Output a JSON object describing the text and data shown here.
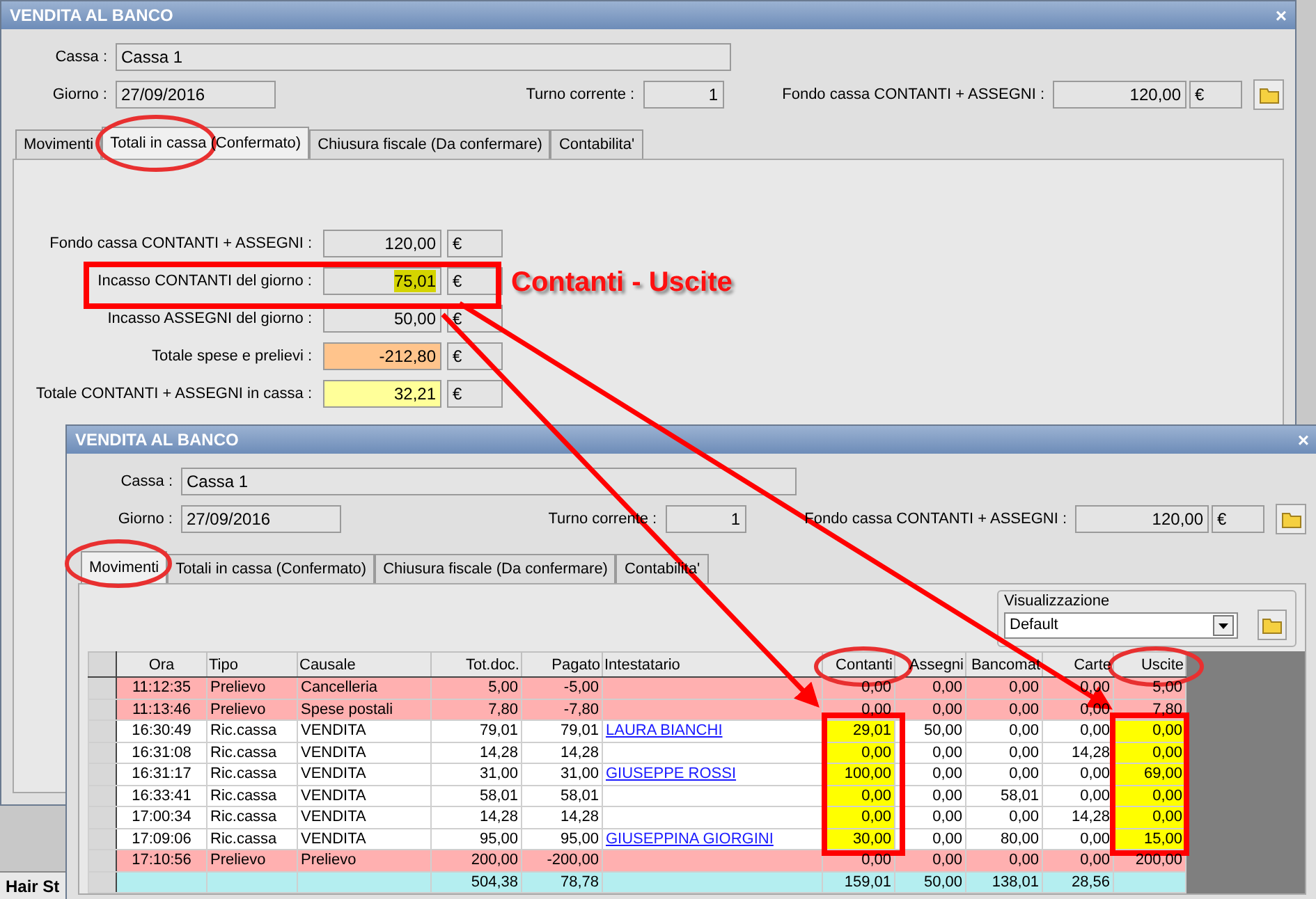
{
  "back_window": {
    "title": "VENDITA AL BANCO",
    "close": "×",
    "header": {
      "cassa_label": "Cassa :",
      "cassa": "Cassa 1",
      "giorno_label": "Giorno :",
      "giorno": "27/09/2016",
      "turno_label": "Turno corrente :",
      "turno": "1",
      "fondo_label": "Fondo cassa CONTANTI + ASSEGNI :",
      "fondo": "120,00",
      "fondo_unit": "€"
    },
    "tabs": [
      {
        "label": "Movimenti",
        "selected": false
      },
      {
        "label": "Totali in cassa (Confermato)",
        "selected": true
      },
      {
        "label": "Chiusura fiscale (Da confermare)",
        "selected": false
      },
      {
        "label": "Contabilita'",
        "selected": false
      }
    ],
    "totals": [
      {
        "label": "Fondo cassa CONTANTI + ASSEGNI :",
        "value": "120,00",
        "unit": "€",
        "kind": "plain"
      },
      {
        "label": "Incasso CONTANTI del giorno :",
        "value": "75,01",
        "unit": "€",
        "kind": "marked"
      },
      {
        "label": "Incasso ASSEGNI del giorno :",
        "value": "50,00",
        "unit": "€",
        "kind": "plain"
      },
      {
        "label": "Totale spese e prelievi :",
        "value": "-212,80",
        "unit": "€",
        "kind": "expense"
      },
      {
        "label": "Totale CONTANTI + ASSEGNI in cassa :",
        "value": "32,21",
        "unit": "€",
        "kind": "total"
      }
    ]
  },
  "annotation": {
    "text": "Contanti - Uscite"
  },
  "taskbar": {
    "item": "Hair St"
  },
  "front_window": {
    "title": "VENDITA AL BANCO",
    "close": "×",
    "header": {
      "cassa_label": "Cassa :",
      "cassa": "Cassa 1",
      "giorno_label": "Giorno :",
      "giorno": "27/09/2016",
      "turno_label": "Turno corrente :",
      "turno": "1",
      "fondo_label": "Fondo cassa CONTANTI + ASSEGNI :",
      "fondo": "120,00",
      "fondo_unit": "€"
    },
    "tabs": [
      {
        "label": "Movimenti",
        "selected": true
      },
      {
        "label": "Totali in cassa (Confermato)",
        "selected": false
      },
      {
        "label": "Chiusura fiscale (Da confermare)",
        "selected": false
      },
      {
        "label": "Contabilita'",
        "selected": false
      }
    ],
    "view_group": {
      "legend": "Visualizzazione",
      "value": "Default"
    },
    "table": {
      "columns": [
        {
          "label": "Ora"
        },
        {
          "label": "Tipo"
        },
        {
          "label": "Causale"
        },
        {
          "label": "Tot.doc."
        },
        {
          "label": "Pagato"
        },
        {
          "label": "Intestatario"
        },
        {
          "label": "Contanti"
        },
        {
          "label": "Assegni"
        },
        {
          "label": "Bancomat"
        },
        {
          "label": "Carte"
        },
        {
          "label": "Uscite"
        }
      ],
      "rows": [
        {
          "kind": "prelievo",
          "highlighted": false,
          "ora": "11:12:35",
          "tipo": "Prelievo",
          "causale": "Cancelleria",
          "tot_doc": "5,00",
          "pagato": "-5,00",
          "contanti": "0,00",
          "assegni": "0,00",
          "bancomat": "0,00",
          "carte": "0,00",
          "uscite": "5,00"
        },
        {
          "kind": "prelievo",
          "highlighted": false,
          "ora": "11:13:46",
          "tipo": "Prelievo",
          "causale": "Spese postali",
          "tot_doc": "7,80",
          "pagato": "-7,80",
          "contanti": "0,00",
          "assegni": "0,00",
          "bancomat": "0,00",
          "carte": "0,00",
          "uscite": "7,80"
        },
        {
          "kind": "incasso",
          "highlighted": true,
          "ora": "16:30:49",
          "tipo": "Ric.cassa",
          "causale": "VENDITA",
          "tot_doc": "79,01",
          "pagato": "79,01",
          "intestatario": "LAURA BIANCHI",
          "contanti": "29,01",
          "assegni": "50,00",
          "bancomat": "0,00",
          "carte": "0,00",
          "uscite": "0,00"
        },
        {
          "kind": "incasso",
          "highlighted": true,
          "ora": "16:31:08",
          "tipo": "Ric.cassa",
          "causale": "VENDITA",
          "tot_doc": "14,28",
          "pagato": "14,28",
          "contanti": "0,00",
          "assegni": "0,00",
          "bancomat": "0,00",
          "carte": "14,28",
          "uscite": "0,00"
        },
        {
          "kind": "incasso",
          "highlighted": true,
          "ora": "16:31:17",
          "tipo": "Ric.cassa",
          "causale": "VENDITA",
          "tot_doc": "31,00",
          "pagato": "31,00",
          "intestatario": "GIUSEPPE ROSSI",
          "contanti": "100,00",
          "assegni": "0,00",
          "bancomat": "0,00",
          "carte": "0,00",
          "uscite": "69,00"
        },
        {
          "kind": "incasso",
          "highlighted": true,
          "ora": "16:33:41",
          "tipo": "Ric.cassa",
          "causale": "VENDITA",
          "tot_doc": "58,01",
          "pagato": "58,01",
          "contanti": "0,00",
          "assegni": "0,00",
          "bancomat": "58,01",
          "carte": "0,00",
          "uscite": "0,00"
        },
        {
          "kind": "incasso",
          "highlighted": true,
          "ora": "17:00:34",
          "tipo": "Ric.cassa",
          "causale": "VENDITA",
          "tot_doc": "14,28",
          "pagato": "14,28",
          "contanti": "0,00",
          "assegni": "0,00",
          "bancomat": "0,00",
          "carte": "14,28",
          "uscite": "0,00"
        },
        {
          "kind": "incasso",
          "highlighted": true,
          "ora": "17:09:06",
          "tipo": "Ric.cassa",
          "causale": "VENDITA",
          "tot_doc": "95,00",
          "pagato": "95,00",
          "intestatario": "GIUSEPPINA GIORGINI",
          "contanti": "30,00",
          "assegni": "0,00",
          "bancomat": "80,00",
          "carte": "0,00",
          "uscite": "15,00"
        },
        {
          "kind": "prelievo",
          "highlighted": false,
          "ora": "17:10:56",
          "tipo": "Prelievo",
          "causale": "Prelievo",
          "tot_doc": "200,00",
          "pagato": "-200,00",
          "contanti": "0,00",
          "assegni": "0,00",
          "bancomat": "0,00",
          "carte": "0,00",
          "uscite": "200,00"
        },
        {
          "kind": "total",
          "highlighted": false,
          "tot_doc": "504,38",
          "pagato": "78,78",
          "contanti": "159,01",
          "assegni": "50,00",
          "bancomat": "138,01",
          "carte": "28,56"
        }
      ]
    }
  }
}
